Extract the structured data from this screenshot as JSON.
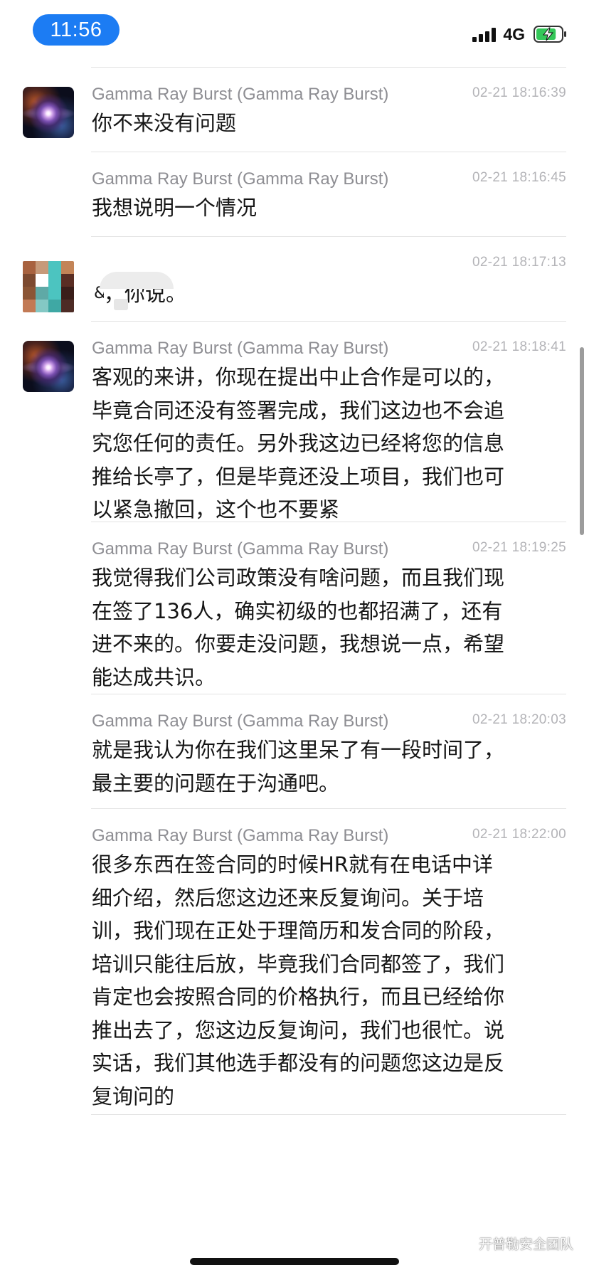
{
  "status_bar": {
    "time": "11:56",
    "network": "4G",
    "battery_level": 0.8,
    "battery_charging": true,
    "accent_color": "#1c7cf3",
    "battery_color": "#34c759"
  },
  "messages": [
    {
      "sender": "Gamma Ray Burst (Gamma Ray Burst)",
      "time": "02-21 18:16:39",
      "text": "你不来没有问题",
      "avatar": "space-avatar"
    },
    {
      "sender": "Gamma Ray Burst (Gamma Ray Burst)",
      "time": "02-21 18:16:45",
      "text": "我想说明一个情况"
    },
    {
      "sender": "",
      "time": "02-21 18:17:13",
      "text": "，你说。",
      "clipped_char": "&",
      "avatar": "pixelated-avatar"
    },
    {
      "sender": "Gamma Ray Burst (Gamma Ray Burst)",
      "time": "02-21 18:18:41",
      "text": "客观的来讲，你现在提出中止合作是可以的，\n毕竟合同还没有签署完成，我们这边也不会追\n究您任何的责任。另外我这边已经将您的信息\n推给长亭了，但是毕竟还没上项目，我们也可\n以紧急撤回，这个也不要紧",
      "avatar": "space-avatar"
    },
    {
      "sender": "Gamma Ray Burst (Gamma Ray Burst)",
      "time": "02-21 18:19:25",
      "text": "我觉得我们公司政策没有啥问题，而且我们现\n在签了136人，确实初级的也都招满了，还有\n进不来的。你要走没问题，我想说一点，希望\n能达成共识。"
    },
    {
      "sender": "Gamma Ray Burst (Gamma Ray Burst)",
      "time": "02-21 18:20:03",
      "text": "就是我认为你在我们这里呆了有一段时间了，\n最主要的问题在于沟通吧。"
    },
    {
      "sender": "Gamma Ray Burst (Gamma Ray Burst)",
      "time": "02-21 18:22:00",
      "text": "很多东西在签合同的时候HR就有在电话中详\n细介绍，然后您这边还来反复询问。关于培\n训，我们现在正处于理简历和发合同的阶段，\n培训只能往后放，毕竟我们合同都签了，我们\n肯定也会按照合同的价格执行，而且已经给你\n推出去了，您这边反复询问，我们也很忙。说\n实话，我们其他选手都没有的问题您这边是反\n复询问的"
    }
  ],
  "pixel_avatar_colors": [
    "#a8623f",
    "#c69a7a",
    "#4cc4c0",
    "#c38457",
    "#7d4a30",
    "#ffffff",
    "#4cc4c0",
    "#5a2e24",
    "#8b5535",
    "#5fa9a6",
    "#4cc4c0",
    "#3a1e1a",
    "#c27a55",
    "#84c8c4",
    "#3fa8a4",
    "#4d2b25"
  ],
  "watermark": {
    "text": "开普勒安全团队",
    "icon": "wechat-channel-icon"
  }
}
